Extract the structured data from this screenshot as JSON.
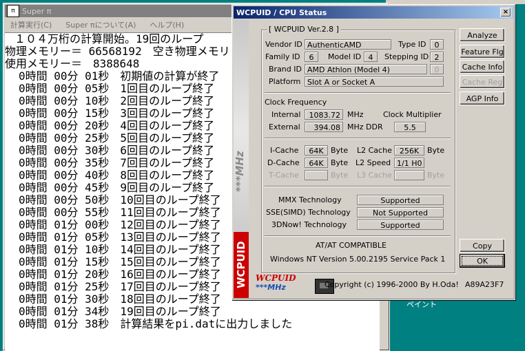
{
  "desktop": {
    "paint_label": "ペイント"
  },
  "superpi": {
    "title": "Super π",
    "icon_text": "SUPER π",
    "menu": [
      "計算実行(C)",
      "Super πについて(A)",
      "ヘルプ(H)"
    ],
    "lines": [
      "１０４万桁の計算開始。19回のループ",
      "物理メモリー＝ 66568192　空き物理メモリ",
      "使用メモリー＝　8388648"
    ],
    "loops": [
      "0時間 00分 01秒　初期値の計算が終了",
      "0時間 00分 05秒　1回目のループ終了",
      "0時間 00分 10秒　2回目のループ終了",
      "0時間 00分 15秒　3回目のループ終了",
      "0時間 00分 20秒　4回目のループ終了",
      "0時間 00分 25秒　5回目のループ終了",
      "0時間 00分 30秒　6回目のループ終了",
      "0時間 00分 35秒　7回目のループ終了",
      "0時間 00分 40秒　8回目のループ終了",
      "0時間 00分 45秒　9回目のループ終了",
      "0時間 00分 50秒　10回目のループ終了",
      "0時間 00分 55秒　11回目のループ終了",
      "0時間 01分 00秒　12回目のループ終了",
      "0時間 01分 05秒　13回目のループ終了",
      "0時間 01分 10秒　14回目のループ終了",
      "0時間 01分 15秒　15回目のループ終了",
      "0時間 01分 20秒　16回目のループ終了",
      "0時間 01分 25秒　17回目のループ終了",
      "0時間 01分 30秒　18回目のループ終了",
      "0時間 01分 34秒　19回目のループ終了",
      "0時間 01分 38秒　計算結果をpi.datに出力しました"
    ]
  },
  "wcpuid": {
    "title": "WCPUID / CPU Status",
    "close": "×",
    "sidebar_mhz": "***MHz",
    "sidebar_brand": "WCPUID",
    "group_title": "[ WCPUID Ver.2.8 ]",
    "vendor_id_label": "Vendor ID",
    "vendor_id": "AuthenticAMD",
    "type_id_label": "Type ID",
    "type_id": "0",
    "family_id_label": "Family ID",
    "family_id": "6",
    "model_id_label": "Model ID",
    "model_id": "4",
    "stepping_id_label": "Stepping ID",
    "stepping_id": "2",
    "brand_id_label": "Brand ID",
    "brand_id": "AMD Athlon (Model 4)",
    "brand_id_num": "0",
    "platform_label": "Platform",
    "platform": "Slot A or Socket A",
    "clock_freq_label": "Clock Frequency",
    "internal_label": "Internal",
    "internal": "1083.72",
    "internal_unit": "MHz",
    "clock_mult_label": "Clock Multiplier",
    "external_label": "External",
    "external": "394.08",
    "external_unit": "MHz DDR",
    "multiplier": "5.5",
    "icache_label": "I-Cache",
    "icache": "64K",
    "icache_unit": "Byte",
    "l2cache_label": "L2 Cache",
    "l2cache": "256K",
    "l2cache_unit": "Byte",
    "dcache_label": "D-Cache",
    "dcache": "64K",
    "dcache_unit": "Byte",
    "l2speed_label": "L2 Speed",
    "l2speed": "1/1 H0",
    "tcache_label": "T-Cache",
    "tcache_unit": "Byte",
    "l3cache_label": "L3 Cache",
    "l3cache_unit": "Byte",
    "mmx_label": "MMX Technology",
    "mmx": "Supported",
    "sse_label": "SSE(SIMD) Technology",
    "sse": "Not Supported",
    "now_label": "3DNow! Technology",
    "now": "Supported",
    "compat": "AT/AT COMPATIBLE",
    "os": "Windows NT  Version 5.00.2195 Service Pack 1",
    "logo_line1": "WCPUID",
    "logo_line2": "***MHz",
    "copyright": "Copyright (c) 1996-2000  By H.Oda!",
    "serial": "A89A23F7",
    "buttons": {
      "analyze": "Analyze",
      "feature": "Feature Flg",
      "cache": "Cache Info",
      "cachereg": "Cache Reg",
      "agp": "AGP Info",
      "copy": "Copy",
      "ok": "OK"
    }
  }
}
